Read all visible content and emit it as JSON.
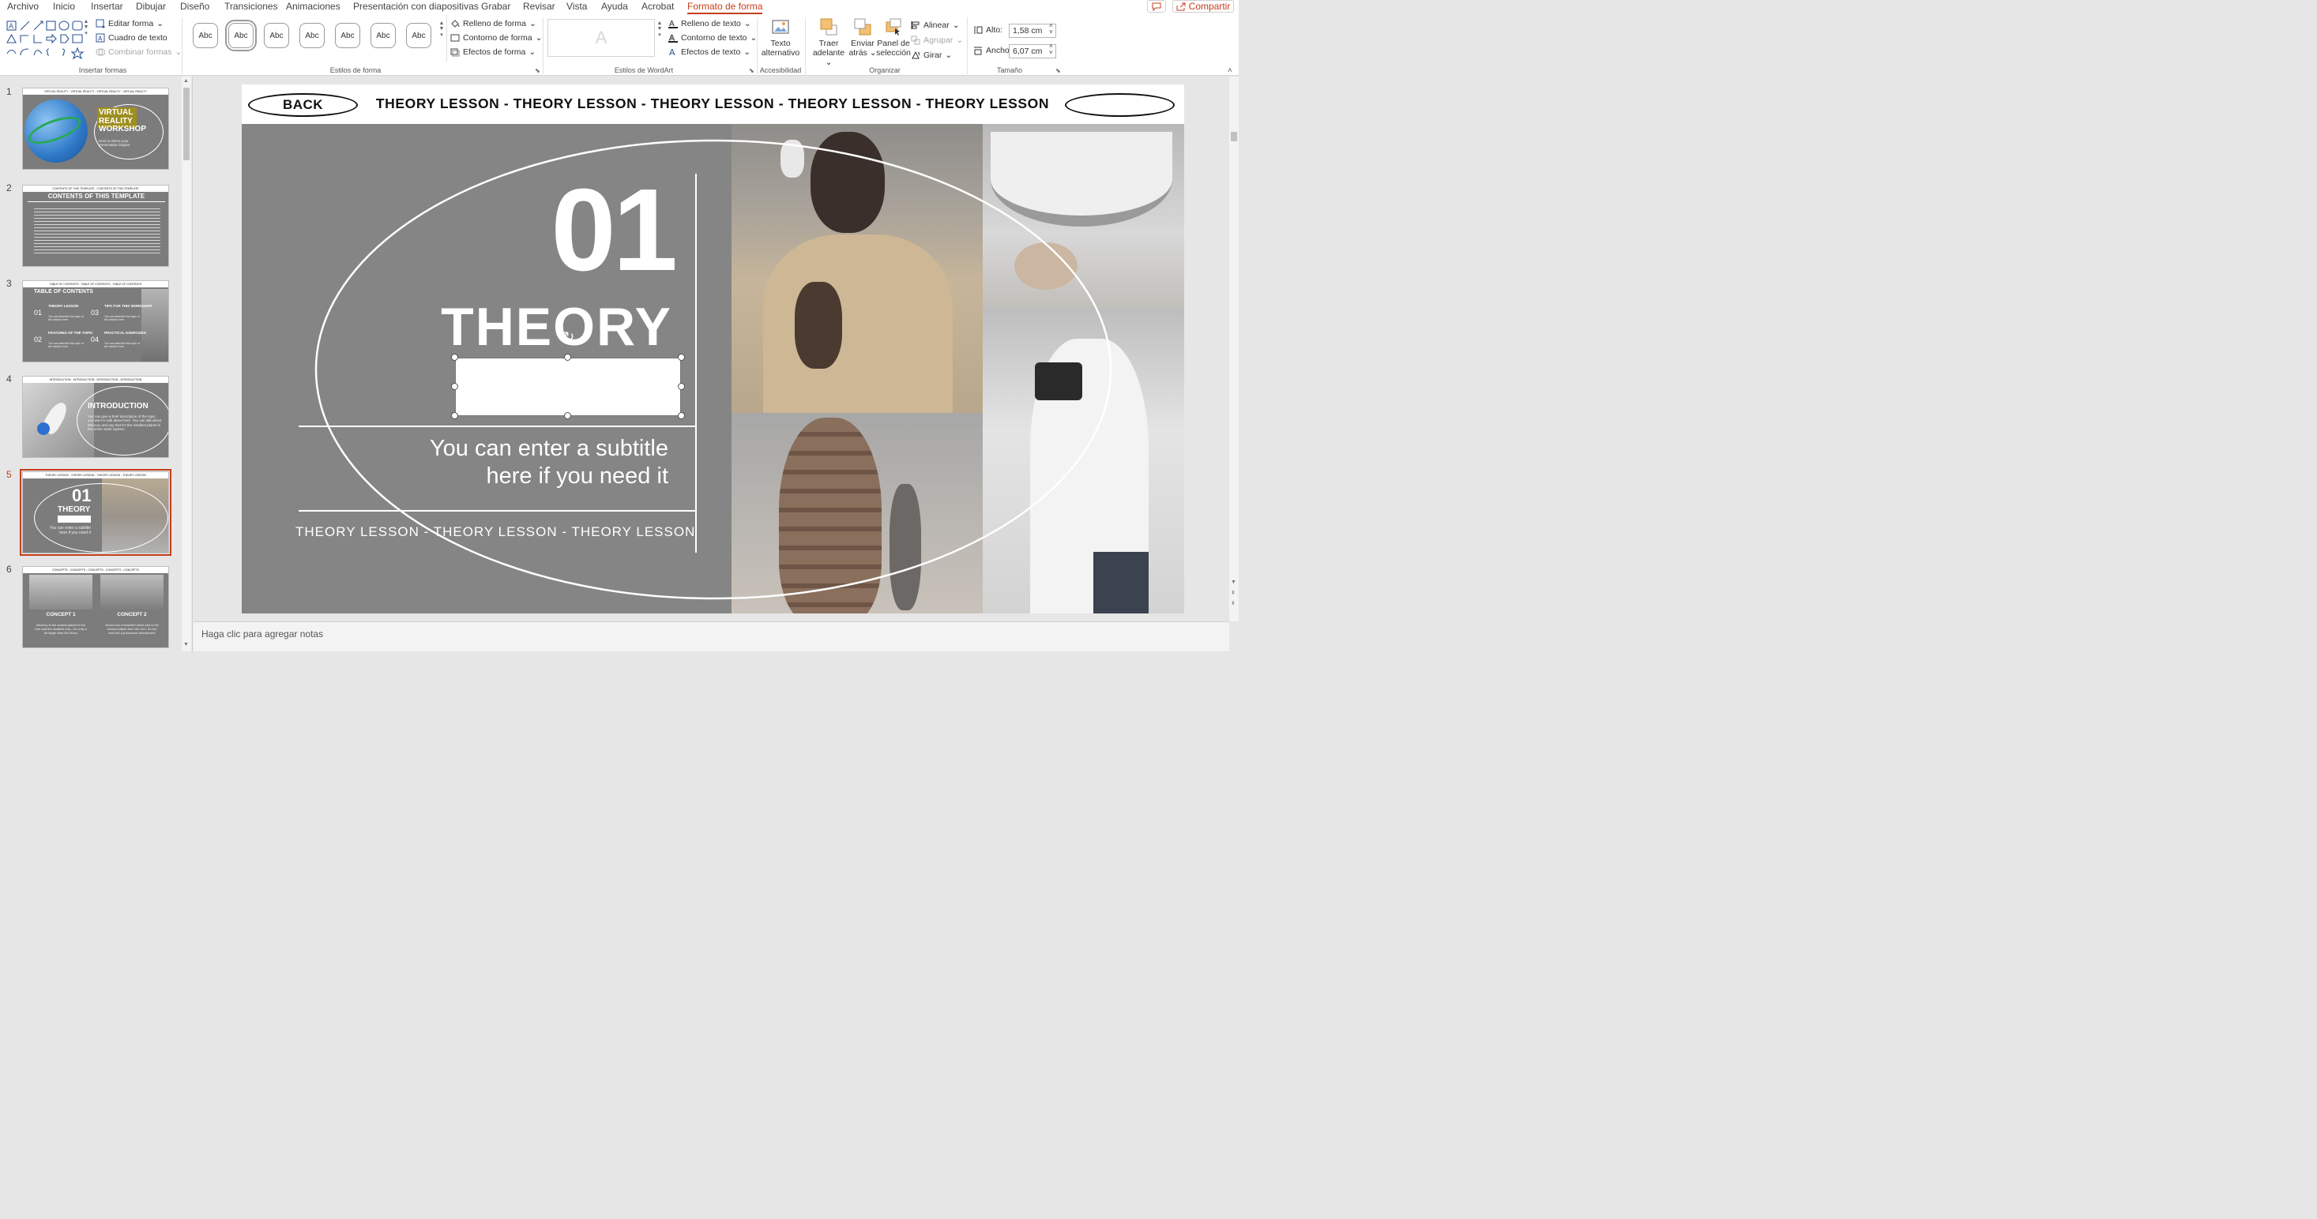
{
  "menu": {
    "tabs": [
      "Archivo",
      "Inicio",
      "Insertar",
      "Dibujar",
      "Diseño",
      "Transiciones",
      "Animaciones",
      "Presentación con diapositivas",
      "Grabar",
      "Revisar",
      "Vista",
      "Ayuda",
      "Acrobat",
      "Formato de forma"
    ],
    "active_tab": "Formato de forma",
    "share_label": "Compartir"
  },
  "ribbon": {
    "insert_shapes": {
      "edit_shape": "Editar forma",
      "text_box": "Cuadro de texto",
      "merge_shapes": "Combinar formas",
      "label": "Insertar formas"
    },
    "shape_styles": {
      "swatch_text": "Abc",
      "fill": "Relleno de forma",
      "outline": "Contorno de forma",
      "effects": "Efectos de forma",
      "label": "Estilos de forma"
    },
    "wordart": {
      "preview": "A",
      "text_fill": "Relleno de texto",
      "text_outline": "Contorno de texto",
      "text_effects": "Efectos de texto",
      "label": "Estilos de WordArt"
    },
    "accessibility": {
      "alt_text_line1": "Texto",
      "alt_text_line2": "alternativo",
      "label": "Accesibilidad"
    },
    "arrange": {
      "bring_forward_1": "Traer",
      "bring_forward_2": "adelante",
      "send_backward_1": "Enviar",
      "send_backward_2": "atrás",
      "selection_pane_1": "Panel de",
      "selection_pane_2": "selección",
      "align": "Alinear",
      "group": "Agrupar",
      "rotate": "Girar",
      "label": "Organizar"
    },
    "size": {
      "height_label": "Alto:",
      "height_value": "1,58 cm",
      "width_label": "Ancho:",
      "width_value": "6,07 cm",
      "label": "Tamaño"
    }
  },
  "thumbnails": [
    {
      "num": "1",
      "title_lines": [
        "VIRTUAL",
        "REALITY",
        "WORKSHOP"
      ],
      "body": "Here is where your presentation begins",
      "bar": "VIRTUAL REALITY - VIRTUAL REALITY - VIRTUAL REALITY - VIRTUAL REALITY"
    },
    {
      "num": "2",
      "title": "CONTENTS OF THIS TEMPLATE",
      "bar": "CONTENTS OF THIS TEMPLATE - CONTENTS OF THIS TEMPLATE"
    },
    {
      "num": "3",
      "title": "TABLE OF CONTENTS",
      "items": [
        {
          "n": "01",
          "t": "THEORY LESSON",
          "d": "You can describe the topic of the section here"
        },
        {
          "n": "03",
          "t": "TIPS FOR THIS WORKSHOP",
          "d": "You can describe the topic of the section here"
        },
        {
          "n": "02",
          "t": "FEATURES OF THE TOPIC",
          "d": "You can describe the topic of the section here"
        },
        {
          "n": "04",
          "t": "PRACTICAL EXERCISES",
          "d": "You can describe the topic of the section here"
        }
      ],
      "bar": "TABLE OF CONTENTS - TABLE OF CONTENTS - TABLE OF CONTENTS"
    },
    {
      "num": "4",
      "title": "INTRODUCTION",
      "body": "You can give a brief description of the topic you want to talk about here. You can talk about Mercury and say that it's the smallest planet in the entire Solar System",
      "bar": "INTRODUCTION - INTRODUCTION - INTRODUCTION - INTRODUCTION"
    },
    {
      "num": "5",
      "number": "01",
      "title": "THEORY",
      "body": "You can enter a subtitle here if you need it",
      "bar": "THEORY LESSON - THEORY LESSON - THEORY LESSON - THEORY LESSON"
    },
    {
      "num": "6",
      "c1": "CONCEPT 1",
      "c2": "CONCEPT 2",
      "d1": "Mercury is the closest planet to the Sun and the smallest one—it's only a bit larger than the Moon",
      "d2": "Venus has a beautiful name and is the second planet from the Sun. It's hot and has a poisonous atmosphere",
      "bar": "CONCEPTS - CONCEPTS - CONCEPTS - CONCEPTS - CONCEPTS"
    }
  ],
  "slide": {
    "back_label": "BACK",
    "header": "THEORY LESSON - THEORY LESSON - THEORY LESSON - THEORY LESSON - THEORY LESSON",
    "number": "01",
    "title": "THEORY",
    "subtitle_line1": "You can enter a subtitle",
    "subtitle_line2": "here if you need it",
    "footer": "THEORY LESSON - THEORY LESSON - THEORY LESSON"
  },
  "notes_placeholder": "Haga clic para agregar notas",
  "colors": {
    "accent": "#c43e1c",
    "slide_bg": "#858585"
  }
}
